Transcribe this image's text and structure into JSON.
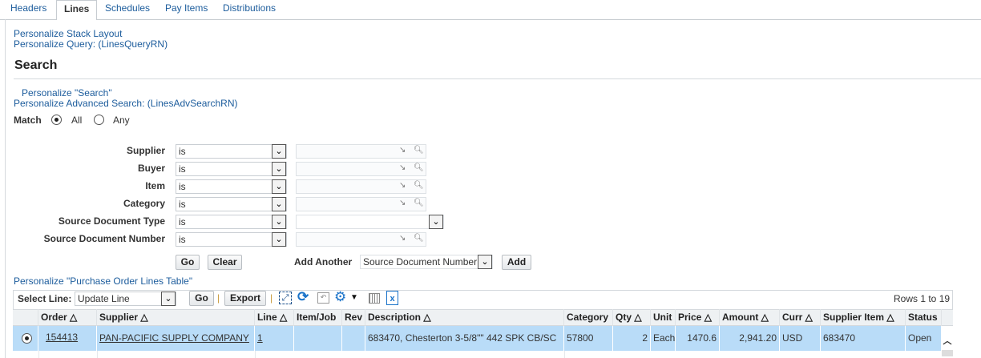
{
  "tabs": [
    "Headers",
    "Lines",
    "Schedules",
    "Pay Items",
    "Distributions"
  ],
  "links": {
    "stack": "Personalize Stack Layout",
    "query": "Personalize Query: (LinesQueryRN)",
    "search": "Personalize \"Search\"",
    "adv": "Personalize Advanced Search: (LinesAdvSearchRN)",
    "table": "Personalize \"Purchase Order Lines Table\""
  },
  "search": {
    "title": "Search",
    "match_label": "Match",
    "match_all": "All",
    "match_any": "Any",
    "fields": [
      {
        "label": "Supplier",
        "op": "is"
      },
      {
        "label": "Buyer",
        "op": "is"
      },
      {
        "label": "Item",
        "op": "is"
      },
      {
        "label": "Category",
        "op": "is"
      },
      {
        "label": "Source Document Type",
        "op": "is"
      },
      {
        "label": "Source Document Number",
        "op": "is"
      }
    ],
    "go": "Go",
    "clear": "Clear",
    "add_another_label": "Add Another",
    "add_another_value": "Source Document Number",
    "add": "Add"
  },
  "toolbar": {
    "select_line_label": "Select Line:",
    "select_line_value": "Update Line",
    "go": "Go",
    "export": "Export",
    "rows": "Rows 1 to 19"
  },
  "table": {
    "headers": [
      "Order",
      "Supplier",
      "Line",
      "Item/Job",
      "Rev",
      "Description",
      "Category",
      "Qty",
      "Unit",
      "Price",
      "Amount",
      "Curr",
      "Supplier Item",
      "Status"
    ],
    "rows": [
      {
        "order": "154413",
        "supplier": "PAN-PACIFIC SUPPLY COMPANY",
        "line": "1",
        "item": "",
        "rev": "",
        "description": "683470, Chesterton 3-5/8\"\" 442 SPK CB/SC",
        "category": "57800",
        "qty": "2",
        "unit": "Each",
        "price": "1470.6",
        "amount": "2,941.20",
        "curr": "USD",
        "supplier_item": "683470",
        "status": "Open"
      }
    ]
  },
  "colors": {
    "link": "#1c5c9c",
    "selected_row": "#b9dcf8",
    "header_bg": "#eef1f3"
  }
}
